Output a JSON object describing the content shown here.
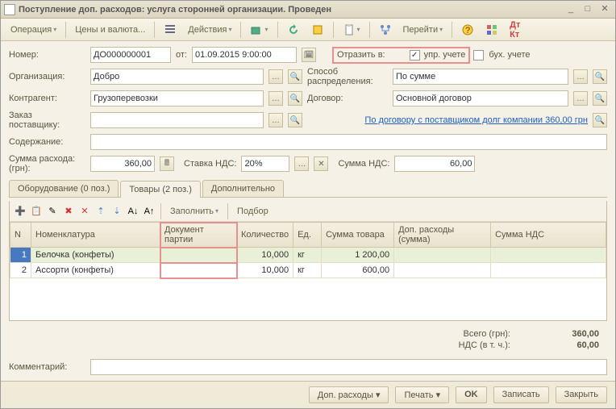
{
  "window": {
    "title": "Поступление доп. расходов: услуга сторонней организации. Проведен"
  },
  "toolbar": {
    "operation": "Операция",
    "prices": "Цены и валюта...",
    "actions": "Действия",
    "goto": "Перейти"
  },
  "fields": {
    "number_label": "Номер:",
    "number": "ДО000000001",
    "from_label": "от:",
    "date": "01.09.2015  9:00:00",
    "reflect_label": "Отразить в:",
    "mgmt_label": "упр. учете",
    "accounting_label": "бух. учете",
    "org_label": "Организация:",
    "org": "Добро",
    "method_label": "Способ распределения:",
    "method": "По сумме",
    "counterparty_label": "Контрагент:",
    "counterparty": "Грузоперевозки",
    "contract_label": "Договор:",
    "contract": "Основной договор",
    "order_label": "Заказ поставщику:",
    "debt_link": "По договору с поставщиком долг компании 360,00 грн",
    "content_label": "Содержание:",
    "sum_label": "Сумма расхода: (грн):",
    "sum": "360,00",
    "vat_rate_label": "Ставка НДС:",
    "vat_rate": "20%",
    "vat_sum_label": "Сумма НДС:",
    "vat_sum": "60,00",
    "comment_label": "Комментарий:"
  },
  "tabs": {
    "equipment": "Оборудование (0 поз.)",
    "goods": "Товары (2 поз.)",
    "additional": "Дополнительно"
  },
  "tabletoolbar": {
    "fill": "Заполнить",
    "select": "Подбор"
  },
  "grid": {
    "headers": {
      "n": "N",
      "nomenclature": "Номенклатура",
      "partydoc": "Документ партии",
      "qty": "Количество",
      "unit": "Ед.",
      "goods_sum": "Сумма товара",
      "addexp": "Доп. расходы (сумма)",
      "vat": "Сумма НДС"
    },
    "rows": [
      {
        "n": "1",
        "nomenclature": "Белочка (конфеты)",
        "partydoc": "",
        "qty": "10,000",
        "unit": "кг",
        "goods_sum": "1 200,00",
        "addexp": "",
        "vat": ""
      },
      {
        "n": "2",
        "nomenclature": "Ассорти (конфеты)",
        "partydoc": "",
        "qty": "10,000",
        "unit": "кг",
        "goods_sum": "600,00",
        "addexp": "",
        "vat": ""
      }
    ]
  },
  "totals": {
    "total_label": "Всего (грн):",
    "total": "360,00",
    "vat_label": "НДС (в т. ч.):",
    "vat": "60,00"
  },
  "buttons": {
    "addexp": "Доп. расходы",
    "print": "Печать",
    "ok": "OK",
    "save": "Записать",
    "close": "Закрыть"
  },
  "chart_data": {
    "type": "table",
    "title": "Товары (2 поз.)",
    "columns": [
      "N",
      "Номенклатура",
      "Документ партии",
      "Количество",
      "Ед.",
      "Сумма товара",
      "Доп. расходы (сумма)",
      "Сумма НДС"
    ],
    "rows": [
      [
        1,
        "Белочка (конфеты)",
        "",
        10.0,
        "кг",
        1200.0,
        null,
        null
      ],
      [
        2,
        "Ассорти (конфеты)",
        "",
        10.0,
        "кг",
        600.0,
        null,
        null
      ]
    ],
    "totals": {
      "Всего (грн)": 360.0,
      "НДС (в т. ч.)": 60.0
    }
  }
}
